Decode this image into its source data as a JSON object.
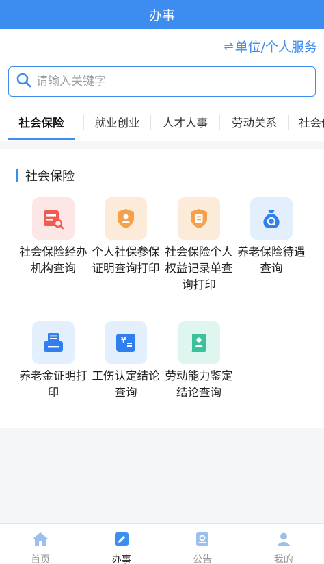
{
  "header": {
    "title": "办事"
  },
  "switch": {
    "arrows": "⇌",
    "label": "单位/个人服务"
  },
  "search": {
    "placeholder": "请输入关键字"
  },
  "tabs": [
    "社会保险",
    "就业创业",
    "人才人事",
    "劳动关系",
    "社会保险"
  ],
  "section": {
    "title": "社会保险",
    "items": [
      {
        "label": "社会保险经办机构查询",
        "icon": "document-search-icon",
        "bg": "#fde7e6",
        "fg": "#ef5b50"
      },
      {
        "label": "个人社保参保证明查询打印",
        "icon": "person-shield-icon",
        "bg": "#fdebd9",
        "fg": "#f6a04b"
      },
      {
        "label": "社会保险个人权益记录单查询打印",
        "icon": "document-shield-icon",
        "bg": "#fdebd9",
        "fg": "#f6a04b"
      },
      {
        "label": "养老保险待遇查询",
        "icon": "money-bag-icon",
        "bg": "#e3effd",
        "fg": "#2f7ff0"
      },
      {
        "label": "养老金证明打印",
        "icon": "printer-icon",
        "bg": "#e3effd",
        "fg": "#2f7ff0"
      },
      {
        "label": "工伤认定结论查询",
        "icon": "yuan-card-icon",
        "bg": "#e3effd",
        "fg": "#2f7ff0"
      },
      {
        "label": "劳动能力鉴定结论查询",
        "icon": "certificate-icon",
        "bg": "#dff5ef",
        "fg": "#3cc29a"
      }
    ]
  },
  "tabbar": [
    {
      "label": "首页",
      "icon": "home-icon"
    },
    {
      "label": "办事",
      "icon": "edit-icon"
    },
    {
      "label": "公告",
      "icon": "notice-icon"
    },
    {
      "label": "我的",
      "icon": "user-icon"
    }
  ],
  "colors": {
    "primary": "#3d8df0",
    "icon_inactive": "#9cc0ee"
  }
}
